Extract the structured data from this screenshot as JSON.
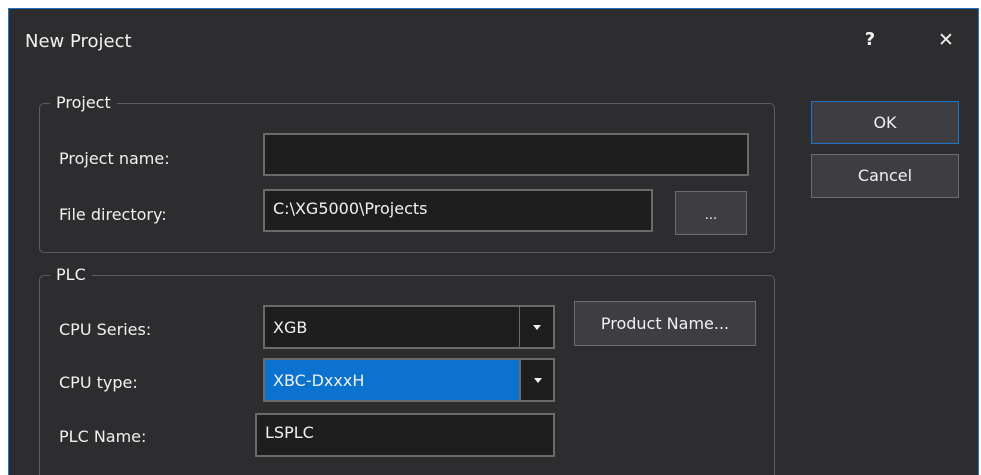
{
  "dialog": {
    "title": "New Project",
    "help_label": "?",
    "close_label": "✕"
  },
  "project_group": {
    "legend": "Project",
    "project_name_label": "Project name:",
    "project_name_value": "",
    "file_directory_label": "File directory:",
    "file_directory_value": "C:\\XG5000\\Projects",
    "browse_label": "..."
  },
  "plc_group": {
    "legend": "PLC",
    "cpu_series_label": "CPU Series:",
    "cpu_series_value": "XGB",
    "product_name_label": "Product Name...",
    "cpu_type_label": "CPU type:",
    "cpu_type_value": "XBC-DxxxH",
    "plc_name_label": "PLC Name:",
    "plc_name_value": "LSPLC"
  },
  "actions": {
    "ok_label": "OK",
    "cancel_label": "Cancel"
  },
  "colors": {
    "accent": "#1e75c8",
    "background": "#2d2d30",
    "selection": "#0b73cf"
  }
}
